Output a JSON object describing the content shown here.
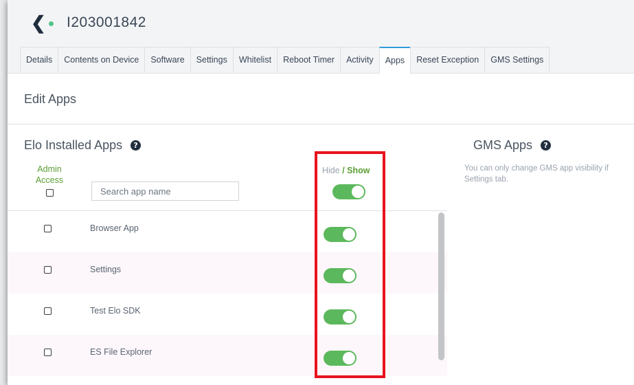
{
  "header": {
    "back_icon": "chevron-left-icon",
    "status_color": "#53c38b",
    "device_id": "I203001842"
  },
  "tabs": [
    {
      "label": "Details",
      "active": false
    },
    {
      "label": "Contents on Device",
      "active": false
    },
    {
      "label": "Software",
      "active": false
    },
    {
      "label": "Settings",
      "active": false
    },
    {
      "label": "Whitelist",
      "active": false
    },
    {
      "label": "Reboot Timer",
      "active": false
    },
    {
      "label": "Activity",
      "active": false
    },
    {
      "label": "Apps",
      "active": true
    },
    {
      "label": "Reset Exception",
      "active": false
    },
    {
      "label": "GMS Settings",
      "active": false
    }
  ],
  "page_title": "Edit Apps",
  "elo_section": {
    "title": "Elo Installed Apps",
    "help_icon": "?",
    "admin_label_line1": "Admin",
    "admin_label_line2": "Access",
    "search_placeholder": "Search app name",
    "hide_label": "Hide",
    "separator": "/",
    "show_label": "Show",
    "master_toggle_on": true,
    "apps": [
      {
        "name": "Browser App",
        "admin": false,
        "shown": true
      },
      {
        "name": "Settings",
        "admin": false,
        "shown": true
      },
      {
        "name": "Test Elo SDK",
        "admin": false,
        "shown": true
      },
      {
        "name": "ES File Explorer",
        "admin": false,
        "shown": true
      }
    ]
  },
  "gms_section": {
    "title": "GMS Apps",
    "help_icon": "?",
    "note_line1": "You can only change GMS app visibility if",
    "note_line2": "Settings tab."
  },
  "colors": {
    "toggle_on": "#5cb85c",
    "accent_green": "#5a9e32",
    "highlight_red": "#e8131d",
    "active_tab": "#2d9cdb"
  }
}
